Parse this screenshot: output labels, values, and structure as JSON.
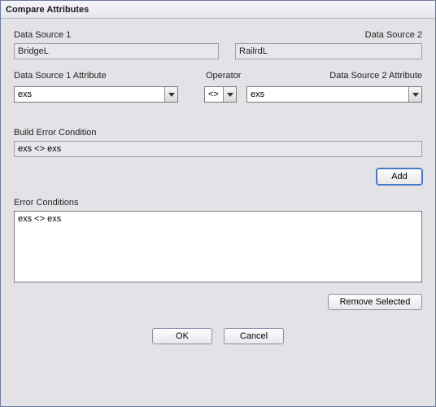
{
  "title": "Compare Attributes",
  "dataSource1": {
    "label": "Data Source 1",
    "value": "BridgeL"
  },
  "dataSource2": {
    "label": "Data Source 2",
    "value": "RailrdL"
  },
  "attr1": {
    "label": "Data Source 1 Attribute",
    "value": "exs"
  },
  "operator": {
    "label": "Operator",
    "value": "<>"
  },
  "attr2": {
    "label": "Data Source 2 Attribute",
    "value": "exs"
  },
  "buildError": {
    "label": "Build Error Condition",
    "value": "exs <> exs"
  },
  "buttons": {
    "add": "Add",
    "remove": "Remove Selected",
    "ok": "OK",
    "cancel": "Cancel"
  },
  "errorConditions": {
    "label": "Error Conditions",
    "value": "exs <> exs"
  }
}
